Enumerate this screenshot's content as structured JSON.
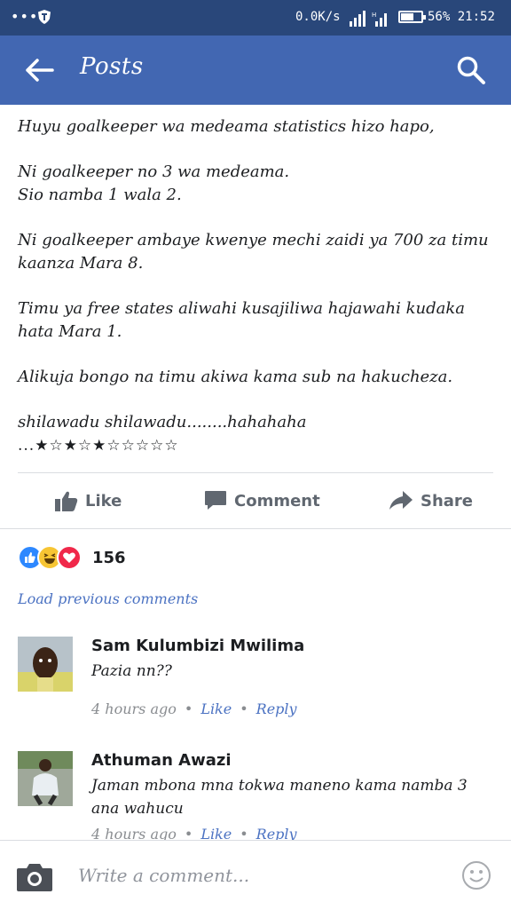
{
  "status_bar": {
    "net_speed": "0.0K/s",
    "battery_pct": "56%",
    "time": "21:52"
  },
  "app_bar": {
    "title": "Posts"
  },
  "post": {
    "paragraphs": [
      [
        "Huyu goalkeeper wa medeama statistics hizo hapo,"
      ],
      [
        "Ni goalkeeper no 3 wa medeama.",
        "Sio namba 1 wala 2."
      ],
      [
        "Ni goalkeeper ambaye kwenye mechi zaidi ya 700 za timu",
        "kaanza Mara 8."
      ],
      [
        "Timu ya free states aliwahi kusajiliwa hajawahi kudaka",
        "hata Mara 1."
      ],
      [
        "Alikuja bongo na timu akiwa kama sub na hakucheza."
      ],
      [
        "shilawadu shilawadu........hahahaha",
        "...★☆★☆★☆☆☆☆☆"
      ]
    ]
  },
  "actions": {
    "like": "Like",
    "comment": "Comment",
    "share": "Share"
  },
  "reactions": {
    "count": "156"
  },
  "comments": {
    "load_previous": "Load previous comments",
    "items": [
      {
        "name": "Sam Kulumbizi Mwilima",
        "text": "Pazia nn??",
        "time": "4 hours ago",
        "like": "Like",
        "reply": "Reply"
      },
      {
        "name": "Athuman Awazi",
        "text": "Jaman mbona mna tokwa maneno kama namba 3 ana wahucu",
        "time": "4 hours ago",
        "like": "Like",
        "reply": "Reply"
      }
    ]
  },
  "composer": {
    "placeholder": "Write a comment..."
  },
  "colors": {
    "header": "#4267b2",
    "status_bar": "#29477a",
    "link": "#4b72c2"
  }
}
